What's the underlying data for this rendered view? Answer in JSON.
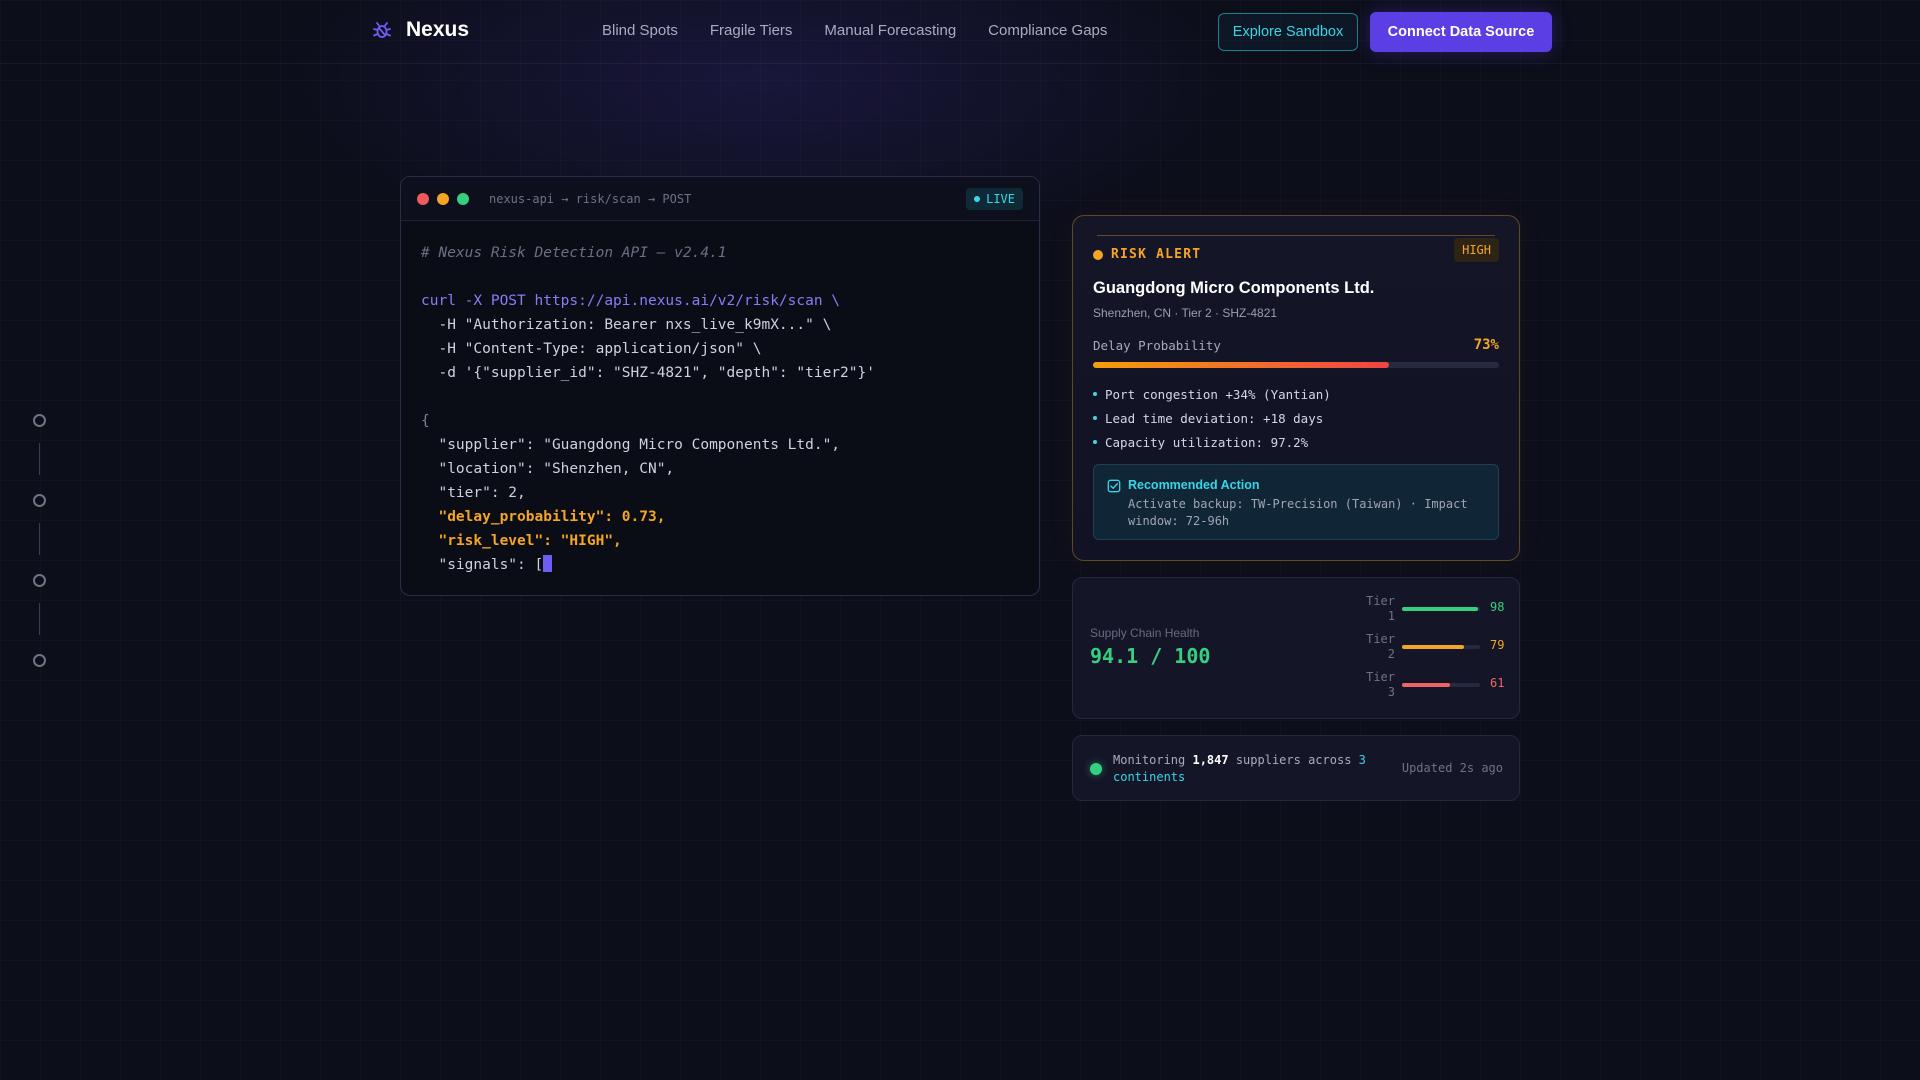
{
  "nav": {
    "brand": "Nexus",
    "links": [
      "Blind Spots",
      "Fragile Tiers",
      "Manual Forecasting",
      "Compliance Gaps"
    ],
    "explore_label": "Explore Sandbox",
    "connect_label": "Connect Data Source"
  },
  "colors": {
    "accent": "#5b3fe4",
    "cyan": "#36d6e7",
    "warning": "#f5a524",
    "success": "#35d07f",
    "danger": "#ef6464"
  },
  "terminal": {
    "title": "nexus-api → risk/scan → POST",
    "status": "LIVE",
    "lines": [
      {
        "text": "# Nexus Risk Detection API — v2.4.1",
        "style": "comment"
      },
      {
        "text": "",
        "style": "plain"
      },
      {
        "text": "curl -X POST https://api.nexus.ai/v2/risk/scan \\",
        "style": "cmd"
      },
      {
        "text": "  -H \"Authorization: Bearer nxs_live_k9mX...\" \\",
        "style": "plain"
      },
      {
        "text": "  -H \"Content-Type: application/json\" \\",
        "style": "plain"
      },
      {
        "text": "  -d '{\"supplier_id\": \"SHZ-4821\", \"depth\": \"tier2\"}'",
        "style": "plain"
      },
      {
        "text": "",
        "style": "plain"
      },
      {
        "text": "{",
        "style": "brace"
      },
      {
        "text": "  \"supplier\": \"Guangdong Micro Components Ltd.\",",
        "style": "plain"
      },
      {
        "text": "  \"location\": \"Shenzhen, CN\",",
        "style": "plain"
      },
      {
        "text": "  \"tier\": 2,",
        "style": "plain"
      },
      {
        "text": "  \"delay_probability\": 0.73,",
        "style": "high"
      },
      {
        "text": "  \"risk_level\": \"HIGH\",",
        "style": "high"
      },
      {
        "text": "  \"signals\": [",
        "style": "plain",
        "cursor": true
      }
    ]
  },
  "alert": {
    "label": "RISK ALERT",
    "severity": "HIGH",
    "supplier": "Guangdong Micro Components Ltd.",
    "meta": "Shenzhen, CN · Tier 2 · SHZ-4821",
    "probability_label": "Delay Probability",
    "probability_text": "73%",
    "probability": 0.73,
    "signals": [
      "Port congestion +34% (Yantian)",
      "Lead time deviation: +18 days",
      "Capacity utilization: 97.2%"
    ],
    "action_title": "Recommended Action",
    "action_text": "Activate backup: TW-Precision (Taiwan) · Impact window: 72-96h"
  },
  "health": {
    "label": "Supply Chain Health",
    "value": "94.1 / 100",
    "tiers": [
      {
        "name": "Tier 1",
        "value": 98,
        "color": "#35d07f"
      },
      {
        "name": "Tier 2",
        "value": 79,
        "color": "#f5a524"
      },
      {
        "name": "Tier 3",
        "value": 61,
        "color": "#ef6464"
      }
    ]
  },
  "monitor": {
    "prefix": "Monitoring ",
    "count": "1,847",
    "middle": " suppliers across ",
    "regions": "3 continents",
    "updated": "Updated 2s ago"
  }
}
